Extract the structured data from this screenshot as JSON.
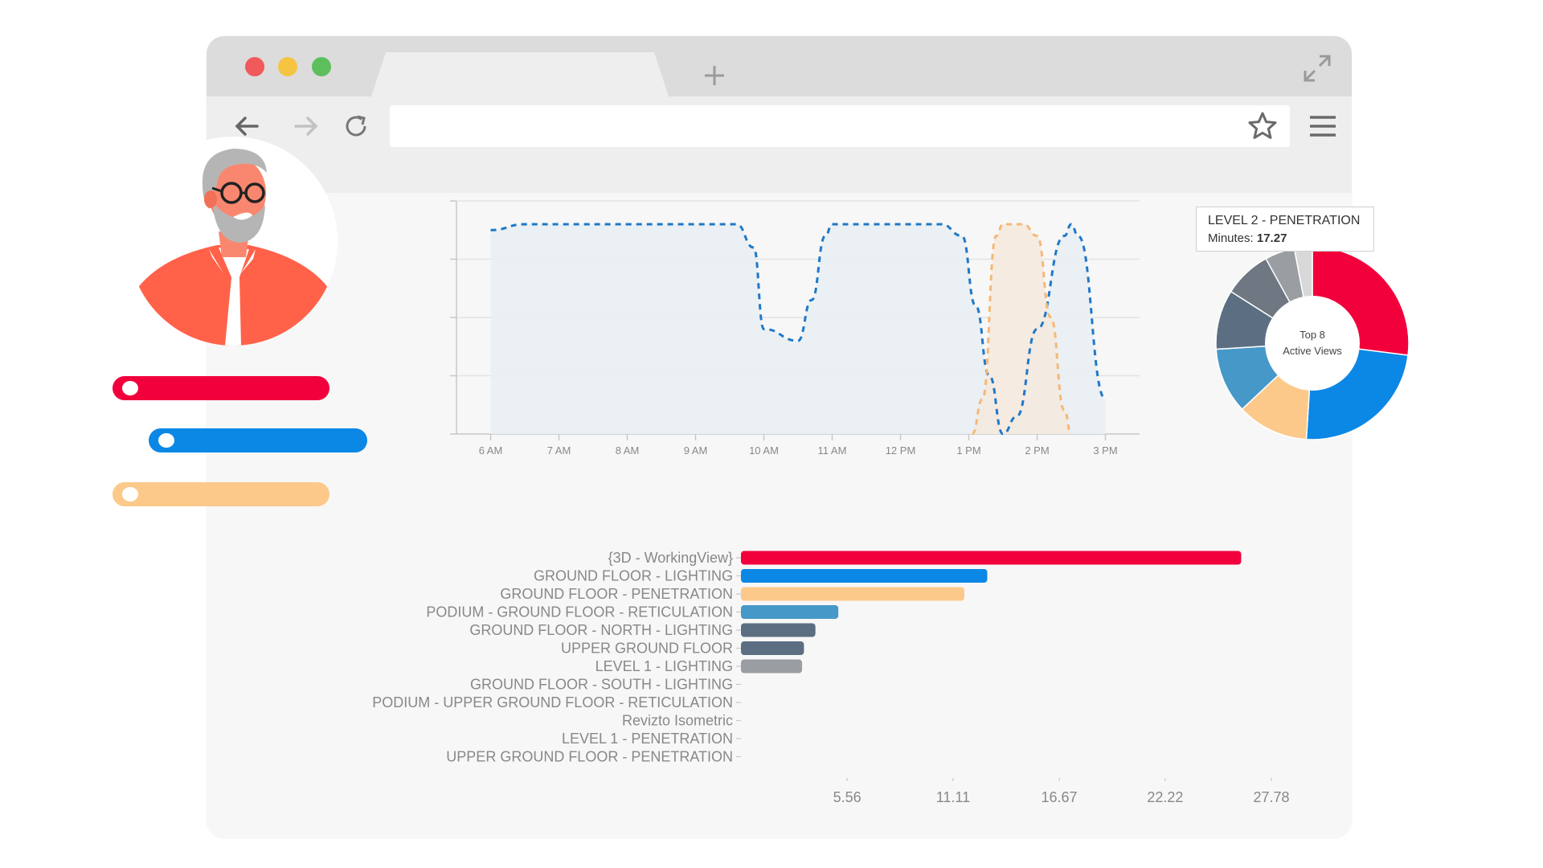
{
  "browser": {
    "new_tab_icon": "plus-icon",
    "expand_icon": "expand-icon",
    "back_icon": "arrow-left-icon",
    "forward_icon": "arrow-right-icon",
    "reload_icon": "reload-icon",
    "bookmark_icon": "star-icon",
    "menu_icon": "hamburger-icon",
    "dots": [
      "#f05a5a",
      "#f5c542",
      "#5cbf5c"
    ]
  },
  "colors": {
    "red": "#f2003c",
    "blue": "#0b87e5",
    "peach": "#fcc98a",
    "lightblue": "#4698c8",
    "slate": "#5c6f82",
    "gray": "#9a9ea3",
    "avatar_shirt": "#ff6249"
  },
  "tooltip": {
    "title": "LEVEL 2 - PENETRATION",
    "label": "Minutes:",
    "value": "17.27"
  },
  "chart_data": [
    {
      "type": "area",
      "x_ticks": [
        "6 AM",
        "7 AM",
        "8 AM",
        "9 AM",
        "10 AM",
        "11 AM",
        "12 PM",
        "1 PM",
        "2 PM",
        "3 PM"
      ],
      "ylim": [
        0,
        4
      ],
      "grid": true,
      "series": [
        {
          "color": "#1f78c8",
          "x": [
            6.0,
            6.5,
            7.0,
            8.0,
            9.0,
            9.6,
            9.85,
            10.0,
            10.5,
            10.7,
            10.9,
            11.0,
            12.0,
            12.6,
            12.9,
            13.1,
            13.3,
            13.5,
            13.7,
            14.0,
            14.4,
            14.5,
            14.6,
            15.0
          ],
          "y": [
            3.5,
            3.6,
            3.6,
            3.6,
            3.6,
            3.6,
            3.2,
            1.8,
            1.6,
            2.3,
            3.4,
            3.6,
            3.6,
            3.6,
            3.4,
            2.2,
            1.0,
            0.0,
            0.3,
            1.8,
            3.4,
            3.6,
            3.4,
            0.6
          ]
        },
        {
          "color": "#f5b877",
          "x": [
            13.05,
            13.2,
            13.4,
            13.5,
            13.8,
            14.0,
            14.2,
            14.4,
            14.5
          ],
          "y": [
            0.0,
            0.6,
            3.4,
            3.6,
            3.6,
            3.4,
            2.0,
            0.4,
            0.0
          ]
        }
      ]
    },
    {
      "type": "pie",
      "center_label": [
        "Top 8",
        "Active Views"
      ],
      "slices": [
        {
          "value": 27.0,
          "color": "#f2003c"
        },
        {
          "value": 24.0,
          "color": "#0b87e5"
        },
        {
          "value": 12.0,
          "color": "#fcc98a"
        },
        {
          "value": 11.0,
          "color": "#4698c8"
        },
        {
          "value": 10.0,
          "color": "#5c6f82"
        },
        {
          "value": 8.0,
          "color": "#6e7782"
        },
        {
          "value": 5.0,
          "color": "#9a9ea3"
        },
        {
          "value": 3.0,
          "color": "#d8d8d8"
        }
      ]
    },
    {
      "type": "bar",
      "orientation": "horizontal",
      "categories": [
        "{3D - WorkingView}",
        "GROUND FLOOR - LIGHTING",
        "GROUND FLOOR - PENETRATION",
        "PODIUM - GROUND FLOOR - RETICULATION",
        "GROUND FLOOR - NORTH - LIGHTING",
        "UPPER GROUND FLOOR",
        "LEVEL 1 - LIGHTING",
        "GROUND FLOOR - SOUTH - LIGHTING",
        "PODIUM - UPPER GROUND FLOOR - RETICULATION",
        "Revizto Isometric",
        "LEVEL 1 - PENETRATION",
        "UPPER GROUND FLOOR - PENETRATION"
      ],
      "values": [
        26.2,
        12.9,
        11.7,
        5.1,
        3.9,
        3.3,
        3.2,
        0,
        0,
        0,
        0,
        0
      ],
      "colors": [
        "#f2003c",
        "#0b87e5",
        "#fcc98a",
        "#4698c8",
        "#5c6f82",
        "#5c6f82",
        "#9a9ea3",
        "#9a9ea3",
        "#9a9ea3",
        "#9a9ea3",
        "#9a9ea3",
        "#9a9ea3"
      ],
      "x_ticks": [
        "5.56",
        "11.11",
        "16.67",
        "22.22",
        "27.78"
      ],
      "xlim": [
        0,
        27.78
      ]
    }
  ]
}
